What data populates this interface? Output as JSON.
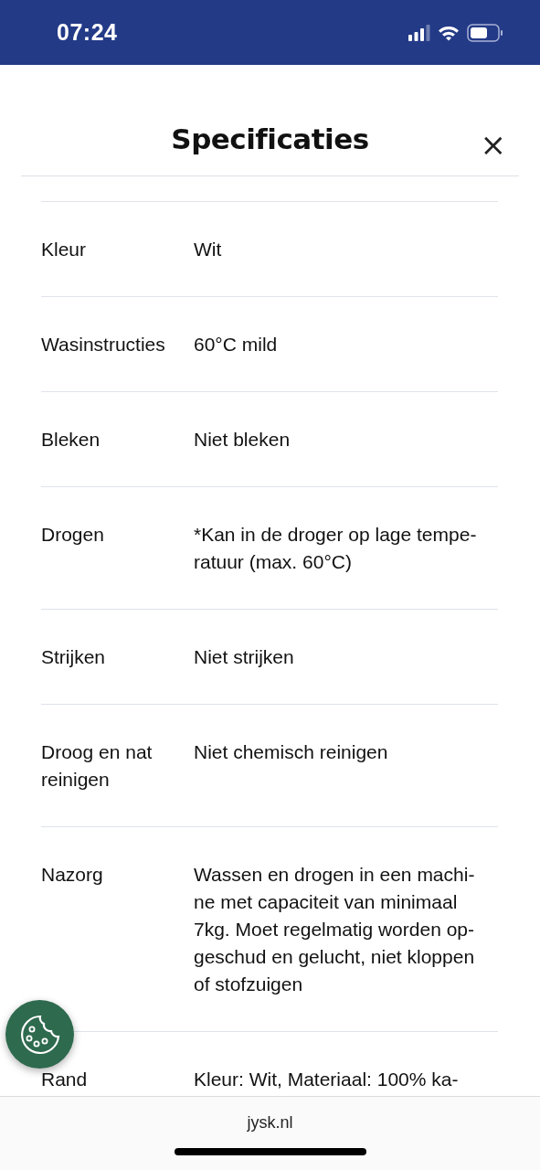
{
  "status_bar": {
    "time": "07:24"
  },
  "header": {
    "title": "Specificaties",
    "close": "×"
  },
  "specs": [
    {
      "label": [
        "Kleur"
      ],
      "value": [
        "Wit"
      ]
    },
    {
      "label": [
        "Wasinstructies"
      ],
      "value": [
        "60°C mild"
      ]
    },
    {
      "label": [
        "Bleken"
      ],
      "value": [
        "Niet bleken"
      ]
    },
    {
      "label": [
        "Drogen"
      ],
      "value": [
        "*Kan in de droger op lage tempe-",
        "ratuur (max. 60°C)"
      ]
    },
    {
      "label": [
        "Strijken"
      ],
      "value": [
        "Niet strijken"
      ]
    },
    {
      "label": [
        "Droog en nat",
        "reinigen"
      ],
      "value": [
        "Niet chemisch reinigen"
      ]
    },
    {
      "label": [
        "Nazorg"
      ],
      "value": [
        "Wassen en drogen in een machi-",
        "ne met capaciteit van minimaal",
        "7kg. Moet regelmatig worden op-",
        "geschud en gelucht, niet kloppen",
        "of stofzuigen"
      ]
    },
    {
      "label": [
        "Rand"
      ],
      "value": [
        "Kleur: Wit, Materiaal: 100% ka-"
      ]
    }
  ],
  "browser_bar": {
    "address": "jysk.nl"
  }
}
